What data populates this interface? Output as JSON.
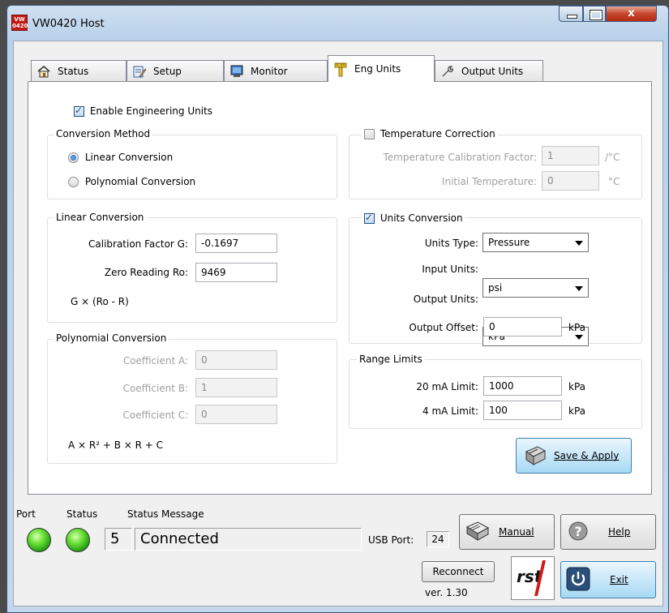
{
  "window": {
    "title": "VW0420 Host",
    "icon_text_top": "VW",
    "icon_text_bottom": "0420",
    "close_glyph": "x"
  },
  "tabs": [
    {
      "label": "Status",
      "icon": "home-icon"
    },
    {
      "label": "Setup",
      "icon": "clipboard-pencil-icon"
    },
    {
      "label": "Monitor",
      "icon": "monitor-icon"
    },
    {
      "label": "Eng Units",
      "icon": "ruler-icon",
      "active": true
    },
    {
      "label": "Output Units",
      "icon": "wrench-icon"
    }
  ],
  "eng_units": {
    "enable_label": "Enable Engineering Units",
    "enable_checked": true,
    "conversion_method": {
      "title": "Conversion Method",
      "options": [
        "Linear Conversion",
        "Polynomial Conversion"
      ],
      "selected": "Linear Conversion"
    },
    "linear": {
      "title": "Linear Conversion",
      "calibration_label": "Calibration Factor G:",
      "calibration_value": "-0.1697",
      "zero_label": "Zero Reading Ro:",
      "zero_value": "9469",
      "formula": "G × (Ro - R)"
    },
    "polynomial": {
      "title": "Polynomial Conversion",
      "coef_a_label": "Coefficient A:",
      "coef_a_value": "0",
      "coef_b_label": "Coefficient B:",
      "coef_b_value": "1",
      "coef_c_label": "Coefficient C:",
      "coef_c_value": "0",
      "formula": "A × R² + B × R + C"
    },
    "temperature": {
      "title": "Temperature Correction",
      "checked": false,
      "factor_label": "Temperature Calibration Factor:",
      "factor_value": "1",
      "factor_unit": "/°C",
      "initial_label": "Initial Temperature:",
      "initial_value": "0",
      "initial_unit": "°C"
    },
    "units_conversion": {
      "title": "Units Conversion",
      "checked": true,
      "units_type_label": "Units Type:",
      "units_type_value": "Pressure",
      "input_units_label": "Input Units:",
      "input_units_value": "psi",
      "output_units_label": "Output Units:",
      "output_units_value": "kPa",
      "offset_label": "Output Offset:",
      "offset_value": "0",
      "offset_unit": "kPa"
    },
    "range_limits": {
      "title": "Range Limits",
      "limit20_label": "20 mA Limit:",
      "limit20_value": "1000",
      "limit20_unit": "kPa",
      "limit4_label": "4 mA Limit:",
      "limit4_value": "100",
      "limit4_unit": "kPa"
    },
    "save_button": "Save & Apply"
  },
  "footer": {
    "port_label": "Port",
    "status_label": "Status",
    "status_message_label": "Status Message",
    "port_led_color": "#3cc21a",
    "status_led_color": "#3cc21a",
    "status_code": "5",
    "status_message": "Connected",
    "usb_port_label": "USB Port:",
    "usb_port_value": "24",
    "manual_button": "Manual",
    "help_button": "Help",
    "reconnect_button": "Reconnect",
    "exit_button": "Exit",
    "logo_text": "rst",
    "version": "ver.  1.30"
  }
}
